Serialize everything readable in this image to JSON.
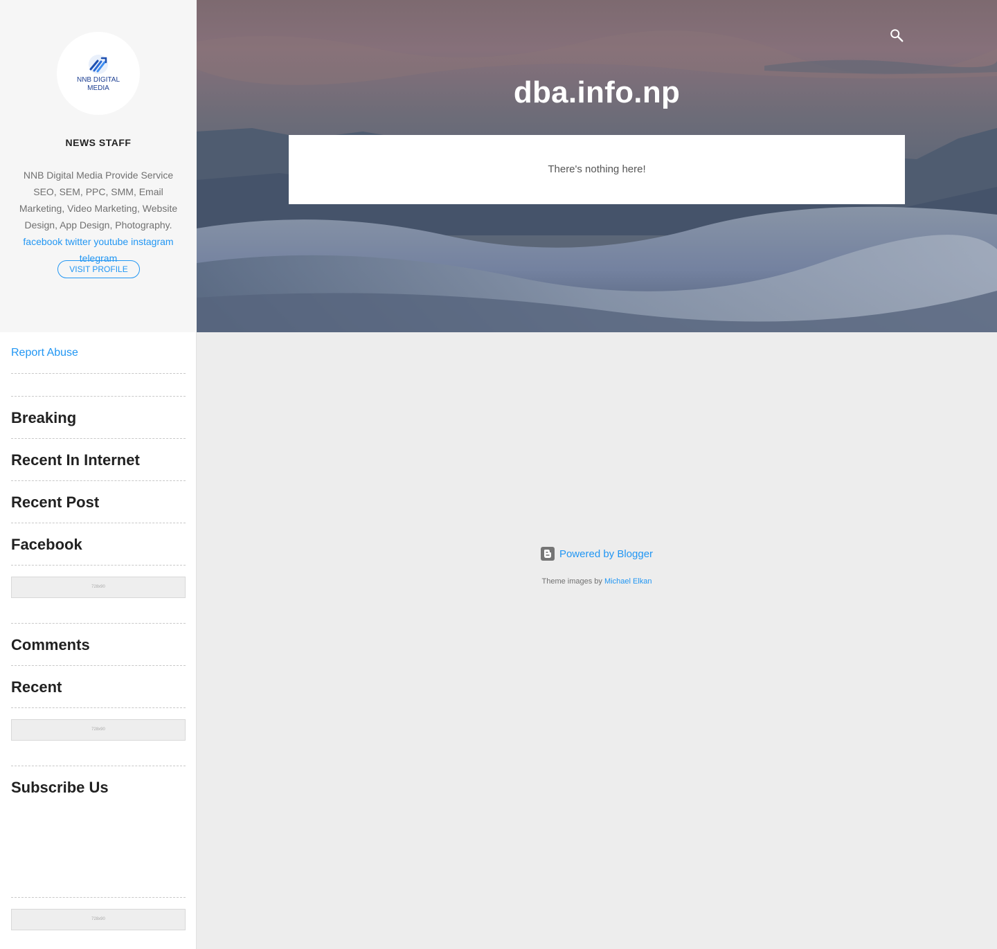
{
  "profile": {
    "avatar_line1": "NNB DIGITAL",
    "avatar_line2": "MEDIA",
    "name": "NEWS STAFF",
    "description": "NNB Digital Media Provide Service SEO, SEM, PPC, SMM, Email Marketing, Video Marketing, Website Design, App Design, Photography.",
    "links": [
      "facebook",
      "twitter",
      "youtube",
      "instagram",
      "telegram"
    ],
    "visit_label": "VISIT PROFILE"
  },
  "sidebar": {
    "report_label": "Report Abuse",
    "widgets": {
      "breaking": "Breaking",
      "recent_internet": "Recent In Internet",
      "recent_post": "Recent Post",
      "facebook": "Facebook",
      "comments": "Comments",
      "recent": "Recent",
      "subscribe": "Subscribe Us"
    },
    "ad_text": "728x90"
  },
  "header": {
    "title": "dba.info.np",
    "search_icon": "search-icon"
  },
  "main": {
    "empty_message": "There's nothing here!"
  },
  "footer": {
    "powered_label": "Powered by Blogger",
    "theme_prefix": "Theme images by",
    "theme_author": "Michael Elkan"
  },
  "colors": {
    "accent": "#2196f3",
    "page_bg": "#ededed",
    "sidebar_bg": "#f6f6f6"
  }
}
